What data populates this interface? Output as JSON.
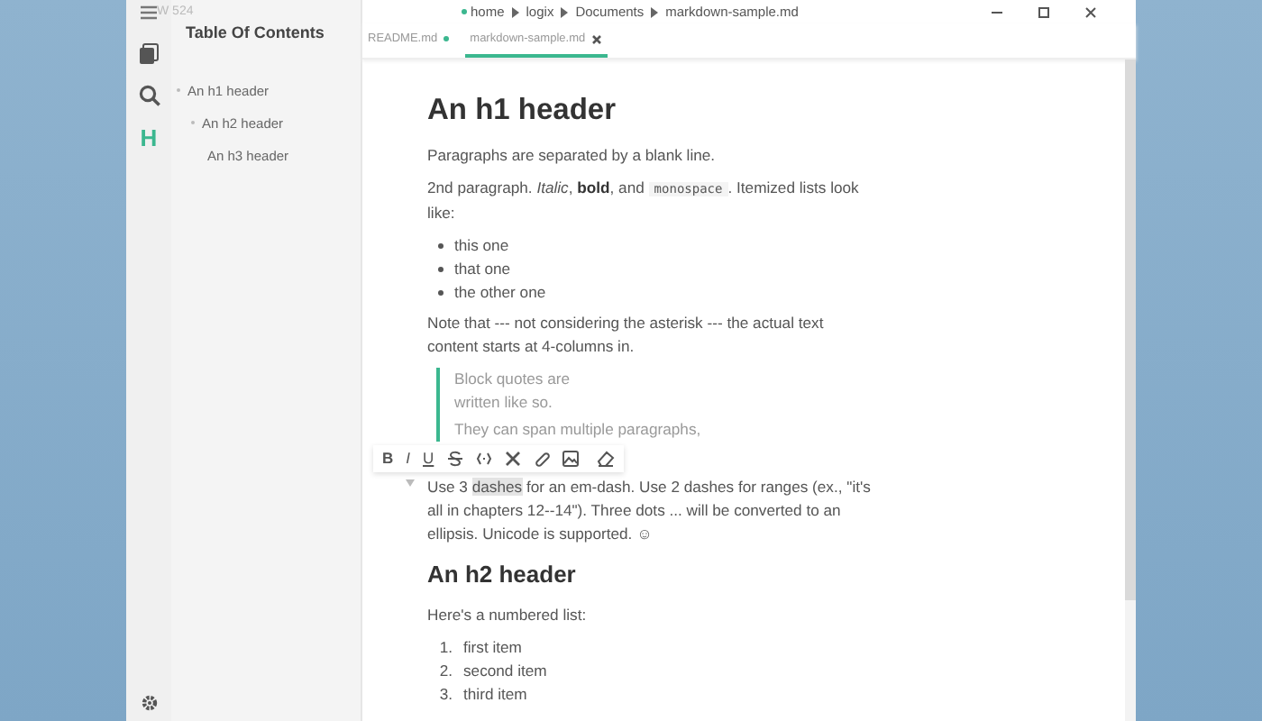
{
  "title_bar": {
    "word_count": "W 524",
    "breadcrumb": [
      "home",
      "logix",
      "Documents",
      "markdown-sample.md"
    ]
  },
  "activity_bar": [
    {
      "kind": "files",
      "selected": false
    },
    {
      "kind": "search",
      "selected": false
    },
    {
      "kind": "toc",
      "label": "H",
      "selected": true
    }
  ],
  "sidebar": {
    "title": "Table Of Contents",
    "toc": [
      {
        "label": "An h1 header",
        "children": [
          {
            "label": "An h2 header",
            "children": [
              {
                "label": "An h3 header"
              }
            ]
          }
        ]
      }
    ]
  },
  "tabs": [
    {
      "label": "README.md",
      "modified": true,
      "selected": false
    },
    {
      "label": "markdown-sample.md",
      "modified": false,
      "selected": true
    }
  ],
  "document": [
    {
      "kind": "h1",
      "text": "An h1 header"
    },
    {
      "kind": "p",
      "segments": [
        {
          "kind": "plain",
          "text": "Paragraphs are separated by a blank line."
        }
      ]
    },
    {
      "kind": "p",
      "segments": [
        {
          "kind": "plain",
          "text": "2nd paragraph. "
        },
        {
          "kind": "emphasis",
          "text": "Italic"
        },
        {
          "kind": "plain",
          "text": ", "
        },
        {
          "kind": "strong",
          "text": "bold"
        },
        {
          "kind": "plain",
          "text": ", and "
        },
        {
          "kind": "code",
          "text": "monospace"
        },
        {
          "kind": "plain",
          "text": ". Itemized lists look like:"
        }
      ]
    },
    {
      "kind": "ul",
      "items": [
        "this one",
        "that one",
        "the other one"
      ]
    },
    {
      "kind": "p",
      "segments": [
        {
          "kind": "plain",
          "text": "Note that --- not considering the asterisk --- the actual text content starts at 4-columns in."
        }
      ]
    },
    {
      "kind": "quote",
      "paragraphs": [
        "Block quotes are\nwritten like so.",
        "They can span multiple paragraphs,"
      ]
    },
    {
      "kind": "format_toolbar",
      "tools": [
        {
          "kind": "bold",
          "label": "B"
        },
        {
          "kind": "italic",
          "label": "I"
        },
        {
          "kind": "underline",
          "label": "U"
        },
        {
          "kind": "strike"
        },
        {
          "kind": "code"
        },
        {
          "kind": "clear"
        },
        {
          "kind": "link"
        },
        {
          "kind": "image"
        },
        {
          "kind": "eraser"
        }
      ]
    },
    {
      "kind": "p",
      "segments": [
        {
          "kind": "plain",
          "text": "Use 3 "
        },
        {
          "kind": "selection",
          "text": "dashes"
        },
        {
          "kind": "plain",
          "text": " for an em-dash. Use 2 dashes for ranges (ex., \"it's all in chapters 12--14\"). Three dots ... will be converted to an ellipsis. Unicode is supported. ☺"
        }
      ]
    },
    {
      "kind": "h2",
      "text": "An h2 header"
    },
    {
      "kind": "p",
      "segments": [
        {
          "kind": "plain",
          "text": "Here's a numbered list:"
        }
      ]
    },
    {
      "kind": "ol",
      "items": [
        {
          "number": "1.",
          "text": "first item"
        },
        {
          "number": "2.",
          "text": "second item"
        },
        {
          "number": "3.",
          "text": "third item"
        }
      ]
    }
  ]
}
